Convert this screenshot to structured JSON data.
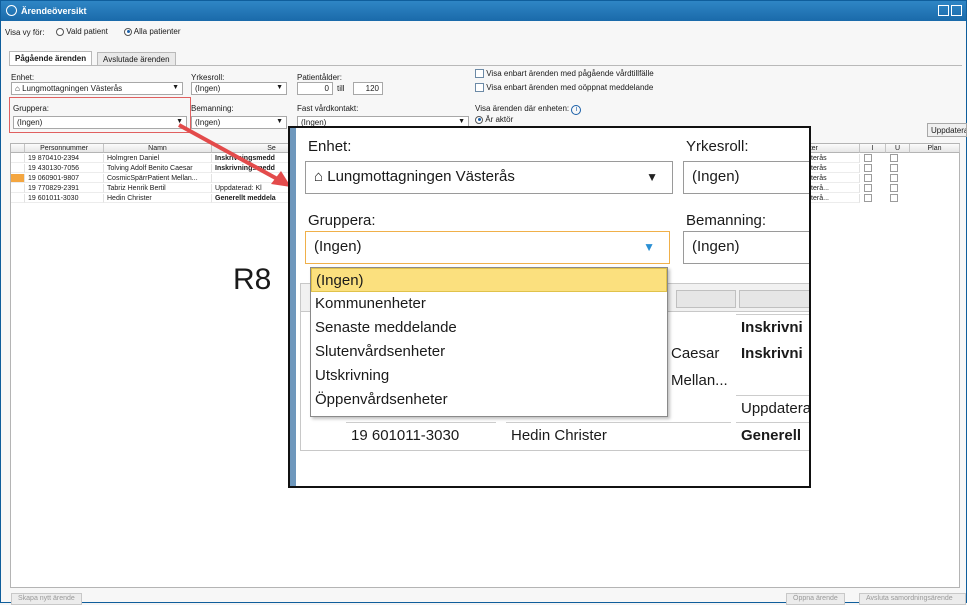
{
  "window": {
    "title": "Ärendeöversikt"
  },
  "view_for": {
    "label": "Visa vy för:",
    "options": [
      "Vald patient",
      "Alla patienter"
    ],
    "selected": "Alla patienter"
  },
  "tabs": [
    {
      "label": "Pågående ärenden",
      "active": true
    },
    {
      "label": "Avslutade ärenden",
      "active": false
    }
  ],
  "filters": {
    "unit": {
      "label": "Enhet:",
      "value": "Lungmottagningen Västerås"
    },
    "role": {
      "label": "Yrkesroll:",
      "value": "(Ingen)"
    },
    "age": {
      "label": "Patientålder:",
      "from": "0",
      "to_label": "till",
      "to": "120"
    },
    "checkbox1": "Visa enbart ärenden med pågående vårdtillfälle",
    "checkbox2": "Visa enbart ärenden med oöppnat meddelande",
    "group": {
      "label": "Gruppera:",
      "value": "(Ingen)"
    },
    "staffing": {
      "label": "Bemanning:",
      "value": "(Ingen)"
    },
    "contact": {
      "label": "Fast vårdkontakt:",
      "value": "(Ingen)"
    },
    "show_where": {
      "label": "Visa ärenden där enheten:",
      "info": "i",
      "option": "Är aktör"
    },
    "update_button": "Uppdatera"
  },
  "grid": {
    "columns": [
      "Personnummer",
      "Namn",
      "Se",
      "meter",
      "I",
      "U",
      "Plan"
    ],
    "rows": [
      {
        "pnr": "19 870410-2394",
        "name": "Holmgren Daniel",
        "status": "Inskrivningsmedd",
        "unit": "Västerås",
        "mark": ""
      },
      {
        "pnr": "19 430130-7056",
        "name": "Tolving Adolf Benito Caesar",
        "status": "Inskrivningsmedd",
        "unit": "Västerås",
        "mark": ""
      },
      {
        "pnr": "19 060901-9807",
        "name": "CosmicSpärrPatient Mellan...",
        "status": "",
        "unit": "Västerås",
        "mark": "#f4a640"
      },
      {
        "pnr": "19 770829-2391",
        "name": "Tabriz Henrik Bertil",
        "status": "Uppdaterad: Kl",
        "unit": "Västerå...",
        "mark": ""
      },
      {
        "pnr": "19 601011-3030",
        "name": "Hedin Christer",
        "status": "Generellt meddela",
        "unit": "Västerå...",
        "mark": ""
      }
    ]
  },
  "annotation": {
    "label": "R8",
    "color": "#f08a8a"
  },
  "footer": {
    "new": "Skapa nytt ärende",
    "open": "Öppna ärende",
    "close": "Avsluta samordningsärende"
  },
  "zoom": {
    "unit_label": "Enhet:",
    "unit_value": "Lungmottagningen Västerås",
    "role_label": "Yrkesroll:",
    "role_value": "(Ingen)",
    "group_label": "Gruppera:",
    "group_value": "(Ingen)",
    "staff_label": "Bemanning:",
    "staff_value": "(Ingen)",
    "options": [
      "(Ingen)",
      "Kommunenheter",
      "Senaste meddelande",
      "Slutenvårdsenheter",
      "Utskrivning",
      "Öppenvårdsenheter"
    ],
    "rows": [
      {
        "name": "",
        "status": "Inskrivni"
      },
      {
        "name": "Caesar",
        "status": "Inskrivni"
      },
      {
        "name": "Mellan...",
        "status": ""
      },
      {
        "name": "",
        "status": "Uppdatera"
      },
      {
        "pnr": "19 601011-3030",
        "name": "Hedin Christer",
        "status": "Generell"
      }
    ]
  }
}
